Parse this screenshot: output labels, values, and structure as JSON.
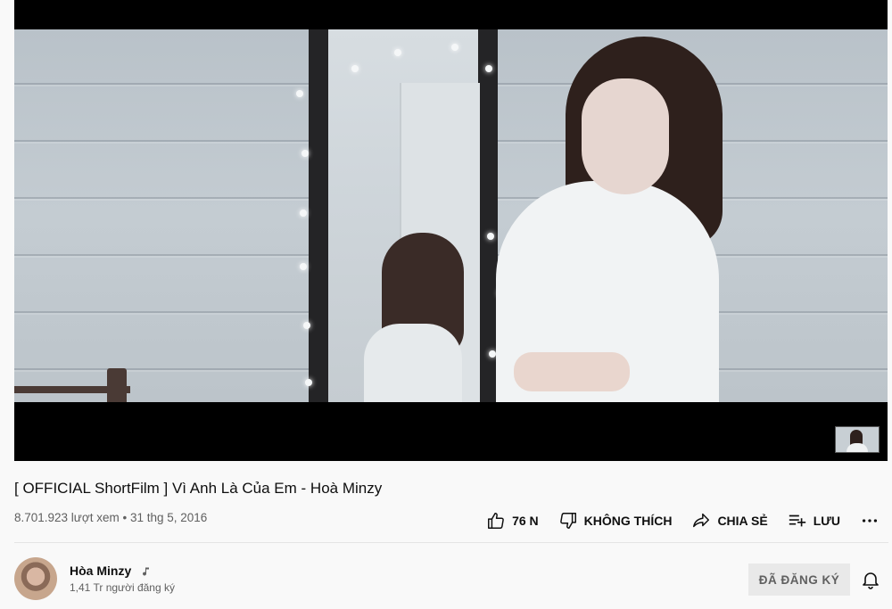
{
  "video": {
    "title": "[ OFFICIAL ShortFilm ] Vì Anh Là Của Em - Hoà Minzy",
    "views": "8.701.923 lượt xem",
    "separator": "•",
    "date": "31 thg 5, 2016"
  },
  "actions": {
    "like_count": "76 N",
    "dislike_label": "KHÔNG THÍCH",
    "share_label": "CHIA SẺ",
    "save_label": "LƯU"
  },
  "channel": {
    "name": "Hòa Minzy",
    "subscribers": "1,41 Tr người đăng ký",
    "subscribed_label": "ĐÃ ĐĂNG KÝ"
  },
  "icons": [
    "thumbs-up-icon",
    "thumbs-down-icon",
    "share-icon",
    "playlist-add-icon",
    "more-icon",
    "music-note-icon",
    "bell-icon"
  ]
}
